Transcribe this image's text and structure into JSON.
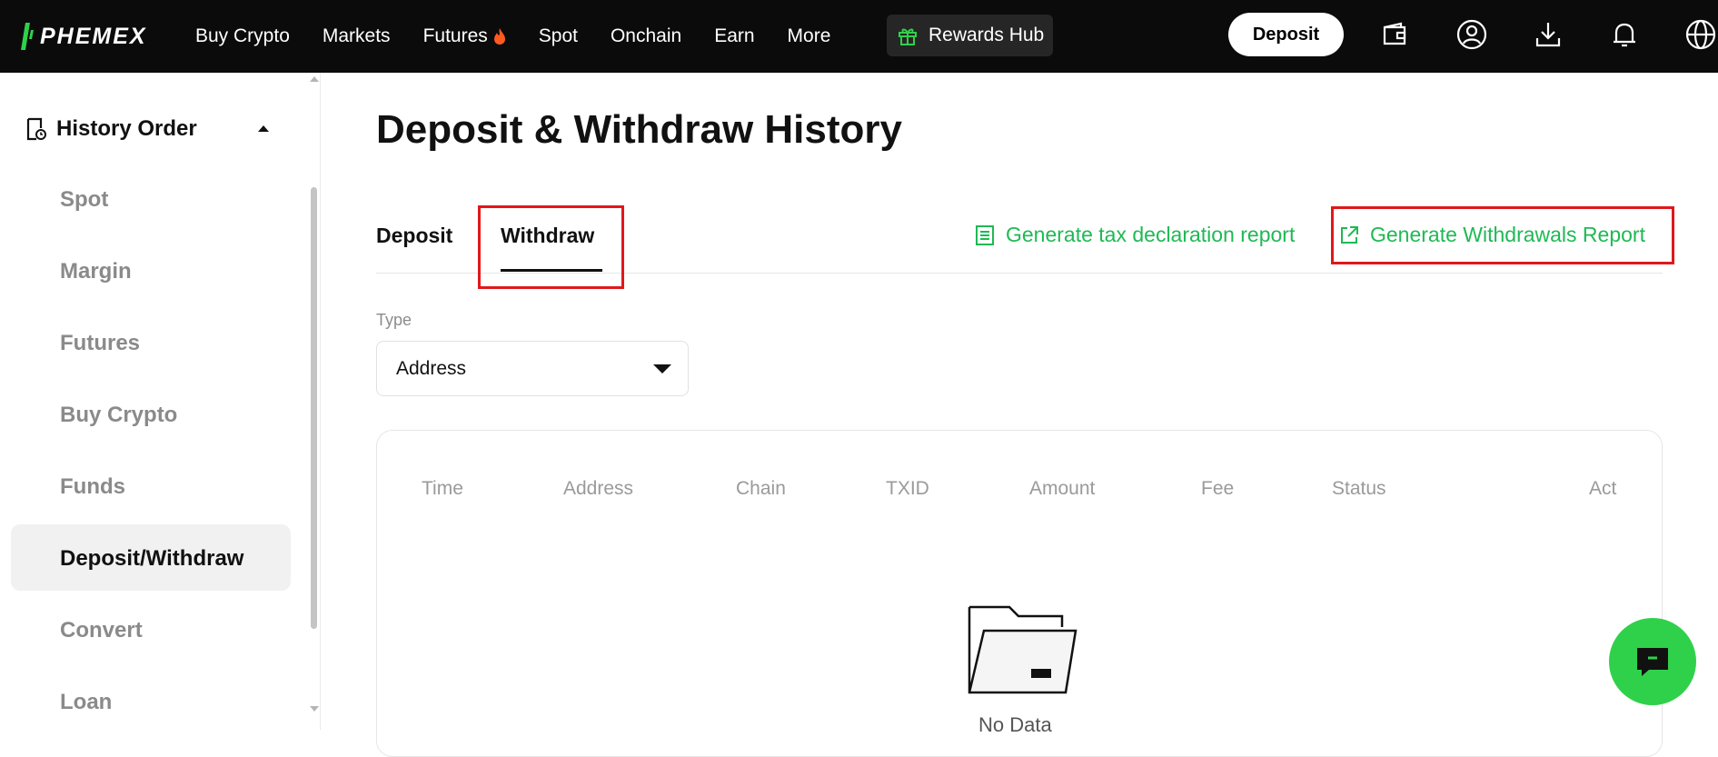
{
  "brand": {
    "name": "PHEMEX",
    "accent": "#1fb954",
    "brand_green": "#2fd14b"
  },
  "nav": {
    "items": [
      "Buy Crypto",
      "Markets",
      "Futures",
      "Spot",
      "Onchain",
      "Earn",
      "More"
    ],
    "rewards_label": "Rewards Hub",
    "deposit_label": "Deposit",
    "icons": [
      "wallet-icon",
      "account-icon",
      "download-icon",
      "bell-icon",
      "globe-icon"
    ]
  },
  "sidebar": {
    "section_title": "History Order",
    "items": [
      "Spot",
      "Margin",
      "Futures",
      "Buy Crypto",
      "Funds",
      "Deposit/Withdraw",
      "Convert",
      "Loan"
    ],
    "active_item": "Deposit/Withdraw"
  },
  "main": {
    "title": "Deposit & Withdraw History",
    "tabs": [
      "Deposit",
      "Withdraw"
    ],
    "active_tab": "Withdraw",
    "tax_report_label": "Generate tax declaration report",
    "withdrawals_report_label": "Generate Withdrawals Report",
    "type_filter": {
      "label": "Type",
      "value": "Address"
    },
    "table": {
      "columns": [
        "Time",
        "Address",
        "Chain",
        "TXID",
        "Amount",
        "Fee",
        "Status",
        "Act"
      ],
      "rows": [],
      "empty_text": "No Data"
    }
  }
}
